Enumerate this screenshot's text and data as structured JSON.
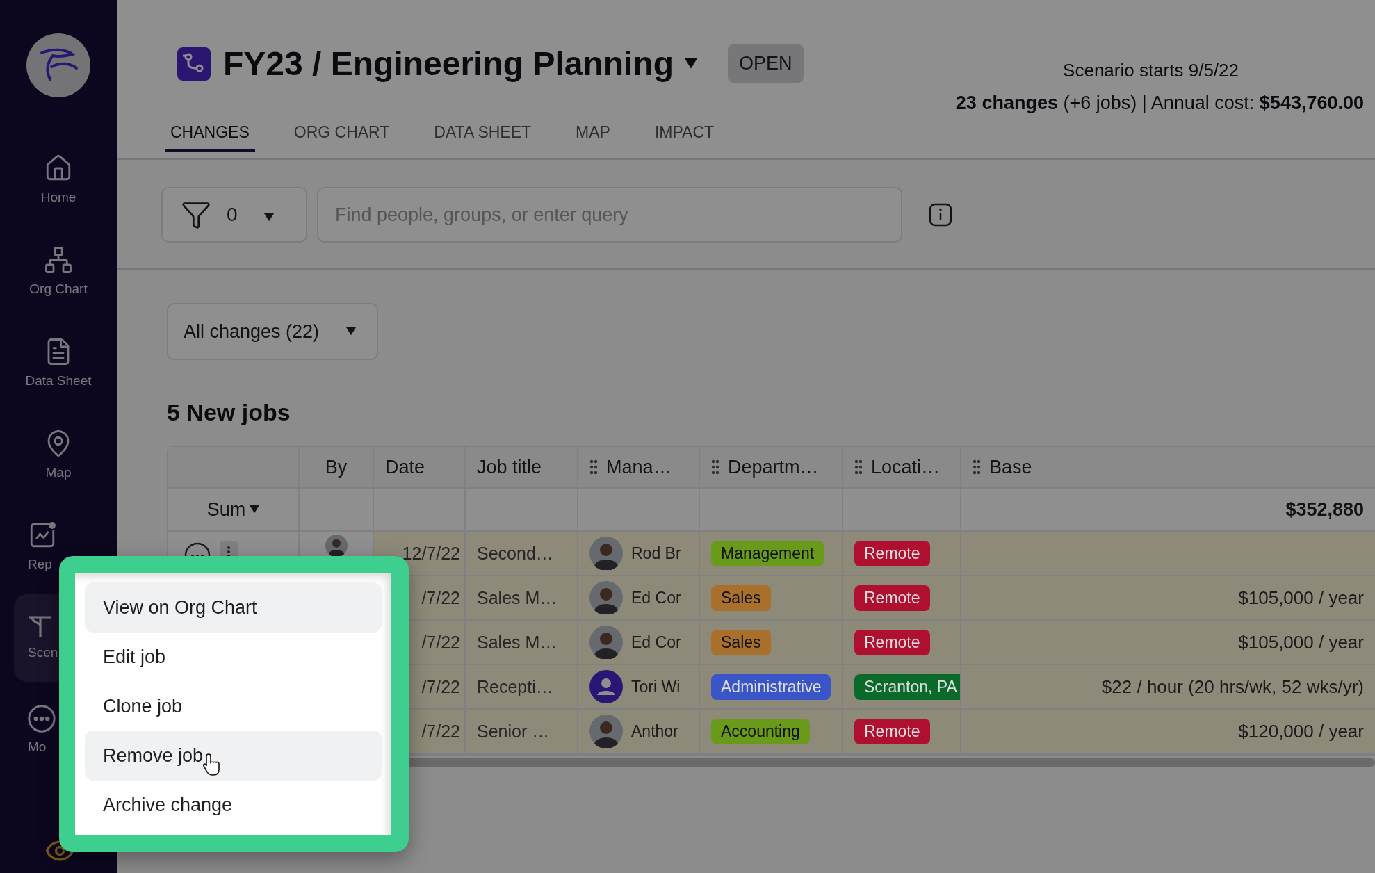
{
  "sidebar": {
    "items": [
      {
        "label": "Home",
        "selected": false,
        "cut": false
      },
      {
        "label": "Org Chart",
        "selected": false,
        "cut": false
      },
      {
        "label": "Data Sheet",
        "selected": false,
        "cut": false
      },
      {
        "label": "Map",
        "selected": false,
        "cut": false
      },
      {
        "label": "Rep",
        "selected": false,
        "cut": true
      },
      {
        "label": "Scen",
        "selected": true,
        "cut": true
      },
      {
        "label": "Mo",
        "selected": false,
        "cut": true
      }
    ]
  },
  "header": {
    "title": "FY23 / Engineering Planning",
    "status": "OPEN",
    "scenario_start": "Scenario starts 9/5/22",
    "summary": "**23 changes** (+6 jobs) | Annual cost: **$543,760.00**"
  },
  "tabs": [
    {
      "label": "CHANGES",
      "selected": true
    },
    {
      "label": "ORG CHART",
      "selected": false
    },
    {
      "label": "DATA SHEET",
      "selected": false
    },
    {
      "label": "MAP",
      "selected": false
    },
    {
      "label": "IMPACT",
      "selected": false
    }
  ],
  "filter": {
    "count": "0"
  },
  "search": {
    "placeholder": "Find people, groups, or enter query"
  },
  "view_select": "All changes (22)",
  "section_title": "5 New jobs",
  "table": {
    "columns": [
      {
        "label": "By",
        "draggable": false
      },
      {
        "label": "Date",
        "draggable": false
      },
      {
        "label": "Job title",
        "draggable": false
      },
      {
        "label": "Mana…",
        "draggable": true
      },
      {
        "label": "Departm…",
        "draggable": true
      },
      {
        "label": "Locati…",
        "draggable": true
      },
      {
        "label": "Base",
        "draggable": true
      }
    ],
    "sum": {
      "label": "Sum",
      "total": "$352,880"
    },
    "rows": [
      {
        "actions": true,
        "by": {
          "kind": "photo"
        },
        "date": "12/7/22",
        "job_title": "Second…",
        "manager": {
          "name": "Rod Br",
          "kind": "photo"
        },
        "department": {
          "label": "Management",
          "color": "#6a9a1a"
        },
        "location": {
          "label": "Remote",
          "color": "#b01030"
        }
      },
      {
        "date": "/7/22",
        "job_title": "Sales M…",
        "manager": {
          "name": "Ed Cor",
          "kind": "photo"
        },
        "department": {
          "label": "Sales",
          "color": "#a8702a"
        },
        "location": {
          "label": "Remote",
          "color": "#b01030"
        },
        "base": "$105,000 / year"
      },
      {
        "date": "/7/22",
        "job_title": "Sales M…",
        "manager": {
          "name": "Ed Cor",
          "kind": "photo"
        },
        "department": {
          "label": "Sales",
          "color": "#a8702a"
        },
        "location": {
          "label": "Remote",
          "color": "#b01030"
        },
        "base": "$105,000 / year"
      },
      {
        "date": "/7/22",
        "job_title": "Recepti…",
        "manager": {
          "name": "Tori Wi",
          "kind": "placeholder"
        },
        "department": {
          "label": "Administrative",
          "color": "#3a55c8"
        },
        "location": {
          "label": "Scranton, PA",
          "color": "#0a6a2a"
        },
        "base": "$22 / hour (20 hrs/wk, 52 wks/yr)"
      },
      {
        "date": "/7/22",
        "job_title": "Senior …",
        "manager": {
          "name": "Anthor",
          "kind": "photo"
        },
        "department": {
          "label": "Accounting",
          "color": "#6a9a1a"
        },
        "location": {
          "label": "Remote",
          "color": "#b01030"
        },
        "base": "$120,000 / year"
      }
    ]
  },
  "context_menu": {
    "items": [
      {
        "label": "View on Org Chart",
        "highlighted": true,
        "pointer": false
      },
      {
        "label": "Edit job",
        "highlighted": false,
        "pointer": false
      },
      {
        "label": "Clone job",
        "highlighted": false,
        "pointer": false
      },
      {
        "label": "Remove job",
        "highlighted": true,
        "pointer": true
      },
      {
        "label": "Archive change",
        "highlighted": false,
        "pointer": false
      }
    ]
  }
}
